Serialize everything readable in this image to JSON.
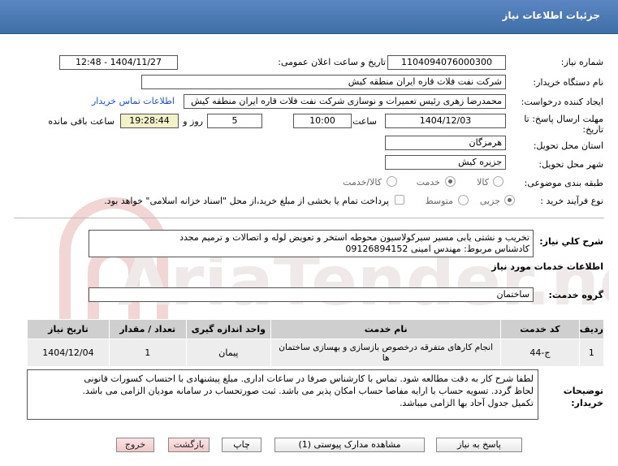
{
  "window": {
    "title": "جزئیات اطلاعات نیاز"
  },
  "form": {
    "need_number_label": "شماره نیاز:",
    "need_number": "1104094076000300",
    "announce_label": "تاریخ و ساعت اعلان عمومی:",
    "announce_value": "1404/11/27 - 12:48",
    "buyer_org_label": "نام دستگاه خریدار:",
    "buyer_org": "شرکت نفت فلات قاره ایران منطقه کیش",
    "creator_label": "ایجاد کننده درخواست:",
    "creator": "محمدرضا  زهری رئیس تعمیرات و نوسازی  شرکت نفت فلات قاره ایران منطقه کیش",
    "contact_link": "اطلاعات تماس خریدار",
    "deadline_label_line1": "مهلت ارسال پاسخ: تا",
    "deadline_label_line2": "تاریخ:",
    "deadline_date": "1404/12/03",
    "time_label": "ساعت",
    "deadline_time": "10:00",
    "days_value": "5",
    "days_label": "روز و",
    "remaining_time": "19:28:44",
    "remaining_label": "ساعت باقی مانده",
    "province_label": "استان محل تحویل:",
    "province": "هرمزگان",
    "city_label": "شهر محل تحویل:",
    "city": "جزیره کیش",
    "category_label": "طبقه بندی موضوعی:",
    "category_options": [
      "کالا",
      "خدمت",
      "کالا/خدمت"
    ],
    "category_selected": "خدمت",
    "purchase_type_label": "نوع فرآیند خرید :",
    "purchase_options": [
      "جزیی",
      "متوسط"
    ],
    "purchase_selected": "جزیی",
    "treasury_note": "پرداخت تمام یا بخشی از مبلغ خرید،از محل \"اسناد خزانه اسلامی\" خواهد بود."
  },
  "description": {
    "label": "شرح کلي نياز:",
    "line1": "تخریب و نشتی یابی مسیر سیرکولاسیون محوطه استخر و تعویض لوله و اتصالات و ترمیم مجدد",
    "line2": "کادشناس مربوط: مهندس امینی 09126894152"
  },
  "services": {
    "section_title": "اطلاعات خدمات مورد نیاز",
    "group_label": "گروه خدمت:",
    "group_value": "ساختمان",
    "columns": [
      "ردیف",
      "کد خدمت",
      "نام خدمت",
      "واحد اندازه گیری",
      "تعداد / مقدار",
      "تاریخ نیاز"
    ],
    "rows": [
      {
        "row": "1",
        "code": "ج-44",
        "name": "انجام کارهای متفرقه درخصوص بازسازی و بهسازی ساختمان ها",
        "unit": "پیمان",
        "qty": "1",
        "date": "1404/12/04"
      }
    ]
  },
  "buyer_notes": {
    "label_line1": "توضیحات",
    "label_line2": "خریدار:",
    "line1": "لطفا شرح کار به دقت مطالعه شود. تماس با کارشناس صرفا در ساعات اداری. مبلغ پیشنهادی با احتساب کسورات قانونی",
    "line2": "لحاظ گردد. تسویه حساب با ارایه مفاصا حساب امکان پذیر می باشد. ثبت صورتحساب در سامانه مودیان الزامی می باشد.",
    "line3": "تکمیل جدول آحاد بها الزامی میباشد."
  },
  "buttons": {
    "reply": "پاسخ به نیاز",
    "attachments": "مشاهده مدارک پیوستی (1)",
    "print": "چاپ",
    "back": "بازگشت",
    "exit": "خروج"
  },
  "watermark": {
    "text": "AriaTender.net"
  }
}
